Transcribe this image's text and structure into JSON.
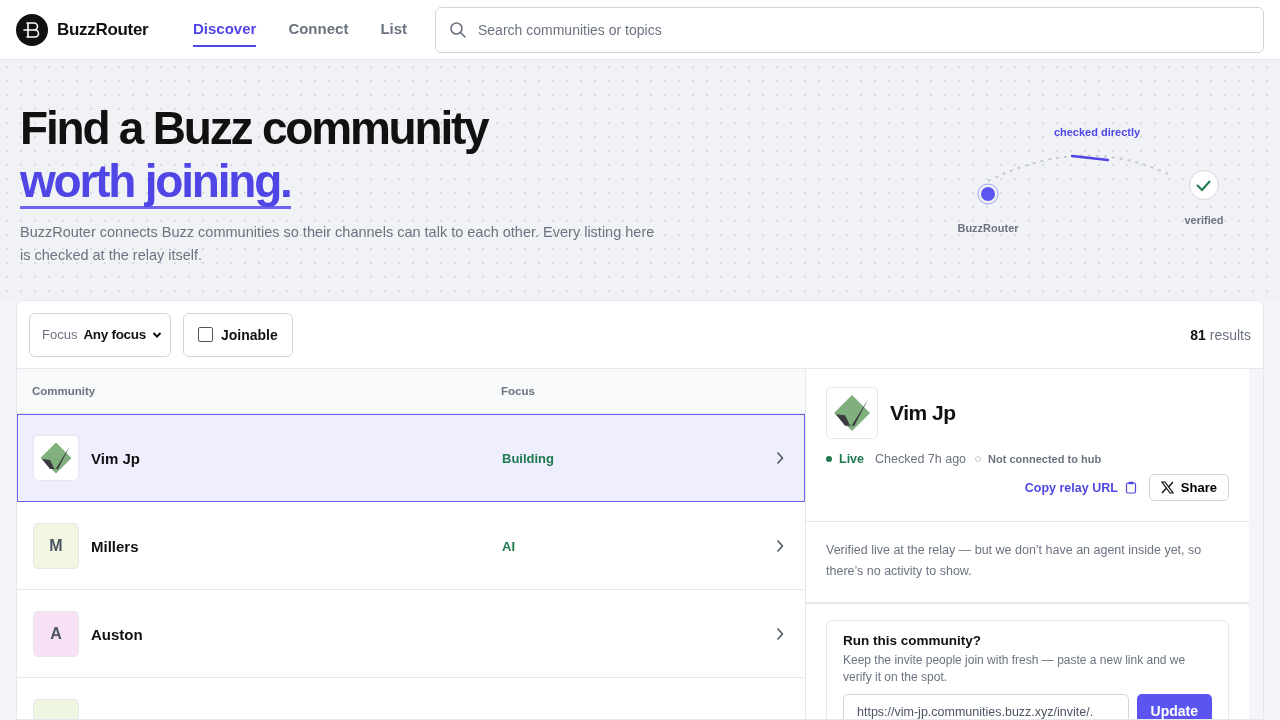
{
  "header": {
    "brand": "BuzzRouter",
    "nav": [
      {
        "label": "Discover",
        "selected": true
      },
      {
        "label": "Connect",
        "selected": false
      },
      {
        "label": "List",
        "selected": false
      }
    ],
    "search": {
      "placeholder": "Search communities or topics"
    }
  },
  "hero": {
    "title": "Find a Buzz community",
    "title_accent": "worth joining.",
    "subtitle": "BuzzRouter connects Buzz communities so their channels can talk to each other. Every listing here is checked at the relay itself.",
    "diagram": {
      "edge_label": "checked directly",
      "source": "BuzzRouter",
      "target": "verified"
    }
  },
  "filters": {
    "focus_label": "Focus",
    "focus_value": "Any focus",
    "joinable": {
      "label": "Joinable",
      "checked": false
    },
    "count": "81",
    "count_label": "results"
  },
  "table": {
    "columns": [
      "Community",
      "Focus"
    ],
    "rows": [
      {
        "kind": "logo",
        "name": "Vim Jp",
        "focus": "Building",
        "selected": true
      },
      {
        "kind": "letter",
        "letter": "M",
        "color": "#f3f7e1",
        "name": "Millers",
        "focus": "AI",
        "selected": false
      },
      {
        "kind": "letter",
        "letter": "A",
        "color": "#f8e1f4",
        "name": "Auston",
        "selected": false
      },
      {
        "kind": "letter",
        "color": "#eef5e0",
        "selected": false
      }
    ]
  },
  "detail": {
    "name": "Vim Jp",
    "live": true,
    "live_label": "Live",
    "checked": "Checked 7h ago",
    "hub_connected": false,
    "hub_label": "Not connected to hub",
    "copy_link": "Copy relay URL",
    "share": "Share",
    "description": "Verified live at the relay — but we don’t have an agent inside yet, so there’s no activity to show.",
    "run": {
      "title": "Run this community?",
      "text": "Keep the invite people join with fresh — paste a new link and we verify it on the spot.",
      "value": "https://vim-jp.communities.buzz.xyz/invite/.",
      "button": "Update"
    }
  }
}
